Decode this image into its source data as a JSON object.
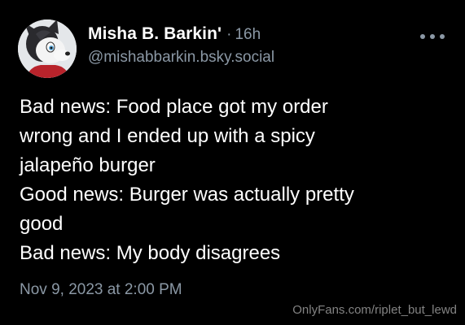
{
  "post": {
    "author": {
      "display_name": "Misha B. Barkin'",
      "handle": "@mishabbarkin.bsky.social",
      "avatar_icon": "furry-avatar"
    },
    "separator": "·",
    "relative_time": "16h",
    "more_icon": "more-options-icon",
    "text_lines": [
      "Bad news: Food place got my order",
      "wrong and I ended up with a spicy",
      "jalapeño burger",
      "Good news: Burger was actually pretty",
      "good",
      "Bad news: My body disagrees"
    ],
    "timestamp": "Nov 9, 2023 at 2:00 PM"
  },
  "watermark": "OnlyFans.com/riplet_but_lewd",
  "colors": {
    "background": "#000000",
    "primary_text": "#ffffff",
    "secondary_text": "#8b98a5"
  }
}
